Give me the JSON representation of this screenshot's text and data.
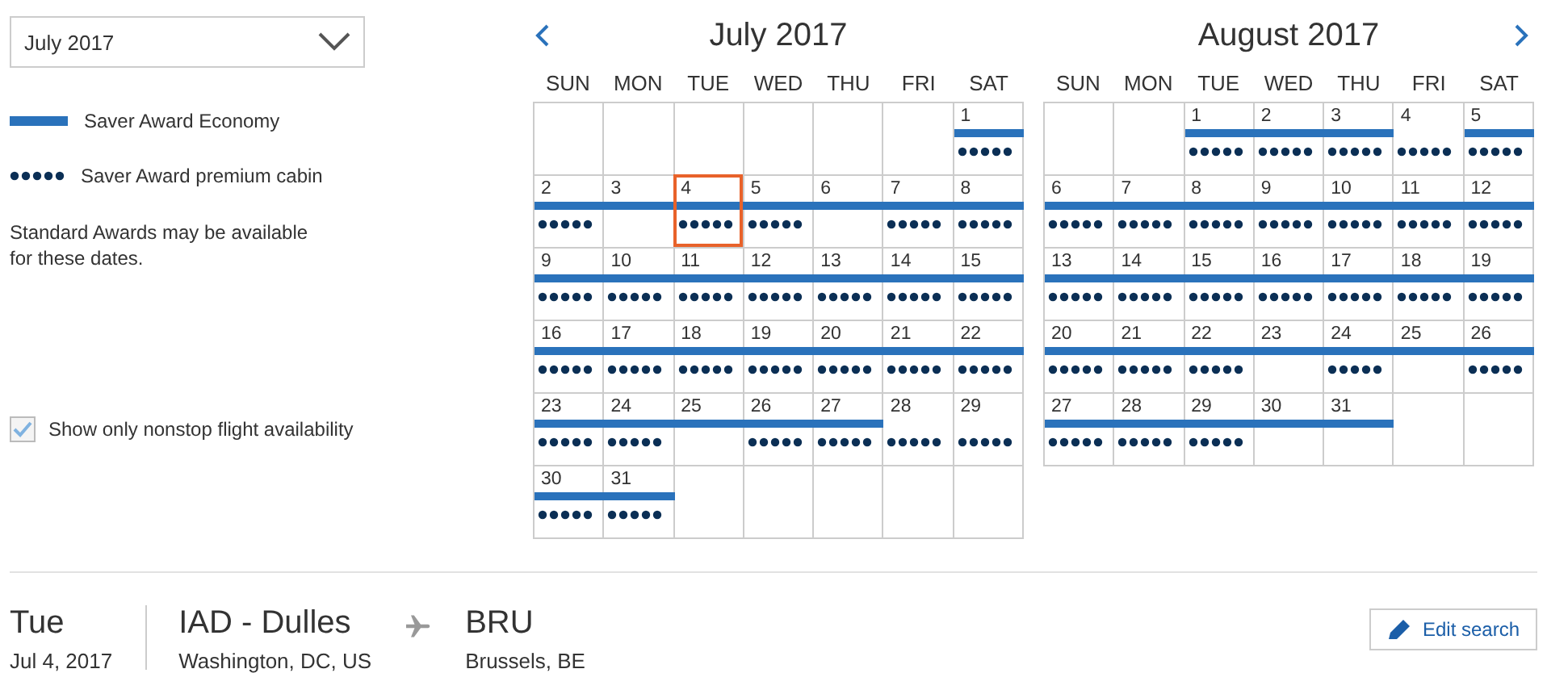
{
  "month_select": {
    "value": "July 2017"
  },
  "legend": [
    {
      "kind": "bar",
      "label": "Saver Award Economy"
    },
    {
      "kind": "dots",
      "label": "Saver Award premium cabin"
    }
  ],
  "note": "Standard Awards may be available for these dates.",
  "nonstop_filter": {
    "label": "Show only nonstop flight availability",
    "checked": true
  },
  "calendars": [
    {
      "title": "July 2017",
      "weekdays": [
        "SUN",
        "MON",
        "TUE",
        "WED",
        "THU",
        "FRI",
        "SAT"
      ],
      "days": [
        {
          "kind": "blank"
        },
        {
          "kind": "blank"
        },
        {
          "kind": "blank"
        },
        {
          "kind": "blank"
        },
        {
          "kind": "blank"
        },
        {
          "kind": "blank"
        },
        {
          "kind": "day",
          "day": "1",
          "economy": true,
          "premium": true,
          "selected": false
        },
        {
          "kind": "day",
          "day": "2",
          "economy": true,
          "premium": true,
          "selected": false
        },
        {
          "kind": "day",
          "day": "3",
          "economy": true,
          "premium": false,
          "selected": false
        },
        {
          "kind": "day",
          "day": "4",
          "economy": true,
          "premium": true,
          "selected": true
        },
        {
          "kind": "day",
          "day": "5",
          "economy": true,
          "premium": true,
          "selected": false
        },
        {
          "kind": "day",
          "day": "6",
          "economy": true,
          "premium": false,
          "selected": false
        },
        {
          "kind": "day",
          "day": "7",
          "economy": true,
          "premium": true,
          "selected": false
        },
        {
          "kind": "day",
          "day": "8",
          "economy": true,
          "premium": true,
          "selected": false
        },
        {
          "kind": "day",
          "day": "9",
          "economy": true,
          "premium": true,
          "selected": false
        },
        {
          "kind": "day",
          "day": "10",
          "economy": true,
          "premium": true,
          "selected": false
        },
        {
          "kind": "day",
          "day": "11",
          "economy": true,
          "premium": true,
          "selected": false
        },
        {
          "kind": "day",
          "day": "12",
          "economy": true,
          "premium": true,
          "selected": false
        },
        {
          "kind": "day",
          "day": "13",
          "economy": true,
          "premium": true,
          "selected": false
        },
        {
          "kind": "day",
          "day": "14",
          "economy": true,
          "premium": true,
          "selected": false
        },
        {
          "kind": "day",
          "day": "15",
          "economy": true,
          "premium": true,
          "selected": false
        },
        {
          "kind": "day",
          "day": "16",
          "economy": true,
          "premium": true,
          "selected": false
        },
        {
          "kind": "day",
          "day": "17",
          "economy": true,
          "premium": true,
          "selected": false
        },
        {
          "kind": "day",
          "day": "18",
          "economy": true,
          "premium": true,
          "selected": false
        },
        {
          "kind": "day",
          "day": "19",
          "economy": true,
          "premium": true,
          "selected": false
        },
        {
          "kind": "day",
          "day": "20",
          "economy": true,
          "premium": true,
          "selected": false
        },
        {
          "kind": "day",
          "day": "21",
          "economy": true,
          "premium": true,
          "selected": false
        },
        {
          "kind": "day",
          "day": "22",
          "economy": true,
          "premium": true,
          "selected": false
        },
        {
          "kind": "day",
          "day": "23",
          "economy": true,
          "premium": true,
          "selected": false
        },
        {
          "kind": "day",
          "day": "24",
          "economy": true,
          "premium": true,
          "selected": false
        },
        {
          "kind": "day",
          "day": "25",
          "economy": true,
          "premium": false,
          "selected": false
        },
        {
          "kind": "day",
          "day": "26",
          "economy": true,
          "premium": true,
          "selected": false
        },
        {
          "kind": "day",
          "day": "27",
          "economy": true,
          "premium": true,
          "selected": false
        },
        {
          "kind": "day",
          "day": "28",
          "economy": false,
          "premium": true,
          "selected": false
        },
        {
          "kind": "day",
          "day": "29",
          "economy": false,
          "premium": true,
          "selected": false
        },
        {
          "kind": "day",
          "day": "30",
          "economy": true,
          "premium": true,
          "selected": false
        },
        {
          "kind": "day",
          "day": "31",
          "economy": true,
          "premium": true,
          "selected": false
        },
        {
          "kind": "blank"
        },
        {
          "kind": "blank"
        },
        {
          "kind": "blank"
        },
        {
          "kind": "blank"
        },
        {
          "kind": "blank"
        }
      ]
    },
    {
      "title": "August 2017",
      "weekdays": [
        "SUN",
        "MON",
        "TUE",
        "WED",
        "THU",
        "FRI",
        "SAT"
      ],
      "days": [
        {
          "kind": "blank"
        },
        {
          "kind": "blank"
        },
        {
          "kind": "day",
          "day": "1",
          "economy": true,
          "premium": true,
          "selected": false
        },
        {
          "kind": "day",
          "day": "2",
          "economy": true,
          "premium": true,
          "selected": false
        },
        {
          "kind": "day",
          "day": "3",
          "economy": true,
          "premium": true,
          "selected": false
        },
        {
          "kind": "day",
          "day": "4",
          "economy": false,
          "premium": true,
          "selected": false
        },
        {
          "kind": "day",
          "day": "5",
          "economy": true,
          "premium": true,
          "selected": false
        },
        {
          "kind": "day",
          "day": "6",
          "economy": true,
          "premium": true,
          "selected": false
        },
        {
          "kind": "day",
          "day": "7",
          "economy": true,
          "premium": true,
          "selected": false
        },
        {
          "kind": "day",
          "day": "8",
          "economy": true,
          "premium": true,
          "selected": false
        },
        {
          "kind": "day",
          "day": "9",
          "economy": true,
          "premium": true,
          "selected": false
        },
        {
          "kind": "day",
          "day": "10",
          "economy": true,
          "premium": true,
          "selected": false
        },
        {
          "kind": "day",
          "day": "11",
          "economy": true,
          "premium": true,
          "selected": false
        },
        {
          "kind": "day",
          "day": "12",
          "economy": true,
          "premium": true,
          "selected": false
        },
        {
          "kind": "day",
          "day": "13",
          "economy": true,
          "premium": true,
          "selected": false
        },
        {
          "kind": "day",
          "day": "14",
          "economy": true,
          "premium": true,
          "selected": false
        },
        {
          "kind": "day",
          "day": "15",
          "economy": true,
          "premium": true,
          "selected": false
        },
        {
          "kind": "day",
          "day": "16",
          "economy": true,
          "premium": true,
          "selected": false
        },
        {
          "kind": "day",
          "day": "17",
          "economy": true,
          "premium": true,
          "selected": false
        },
        {
          "kind": "day",
          "day": "18",
          "economy": true,
          "premium": true,
          "selected": false
        },
        {
          "kind": "day",
          "day": "19",
          "economy": true,
          "premium": true,
          "selected": false
        },
        {
          "kind": "day",
          "day": "20",
          "economy": true,
          "premium": true,
          "selected": false
        },
        {
          "kind": "day",
          "day": "21",
          "economy": true,
          "premium": true,
          "selected": false
        },
        {
          "kind": "day",
          "day": "22",
          "economy": true,
          "premium": true,
          "selected": false
        },
        {
          "kind": "day",
          "day": "23",
          "economy": true,
          "premium": false,
          "selected": false
        },
        {
          "kind": "day",
          "day": "24",
          "economy": true,
          "premium": true,
          "selected": false
        },
        {
          "kind": "day",
          "day": "25",
          "economy": true,
          "premium": false,
          "selected": false
        },
        {
          "kind": "day",
          "day": "26",
          "economy": true,
          "premium": true,
          "selected": false
        },
        {
          "kind": "day",
          "day": "27",
          "economy": true,
          "premium": true,
          "selected": false
        },
        {
          "kind": "day",
          "day": "28",
          "economy": true,
          "premium": true,
          "selected": false
        },
        {
          "kind": "day",
          "day": "29",
          "economy": true,
          "premium": true,
          "selected": false
        },
        {
          "kind": "day",
          "day": "30",
          "economy": true,
          "premium": false,
          "selected": false
        },
        {
          "kind": "day",
          "day": "31",
          "economy": true,
          "premium": false,
          "selected": false
        },
        {
          "kind": "blank"
        },
        {
          "kind": "blank"
        }
      ]
    }
  ],
  "trip": {
    "weekday": "Tue",
    "date": "Jul 4, 2017",
    "origin": "IAD - Dulles",
    "origin_city": "Washington, DC, US",
    "destination": "BRU",
    "destination_city": "Brussels, BE"
  },
  "edit_button": "Edit search"
}
